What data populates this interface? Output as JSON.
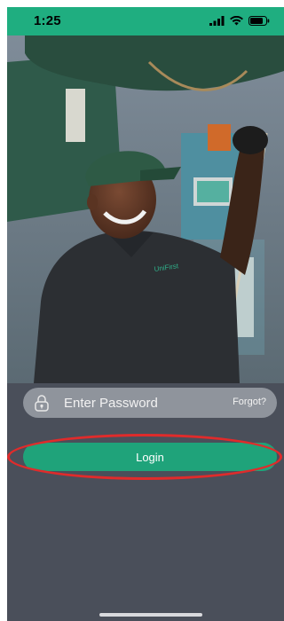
{
  "status_bar": {
    "time": "1:25",
    "icons": [
      "signal-icon",
      "wifi-icon",
      "battery-icon"
    ]
  },
  "hero": {
    "image": "photo of a smiling worker in a cap and dark polo shirt in an industrial facility",
    "shirt_logo": "UniFirst"
  },
  "login_form": {
    "password_placeholder": "Enter Password",
    "forgot_label": "Forgot?",
    "login_label": "Login"
  },
  "colors": {
    "accent": "#1fa37a",
    "status_bar": "#1fae80",
    "background": "#4a4f5a",
    "highlight": "#e02b2b"
  }
}
